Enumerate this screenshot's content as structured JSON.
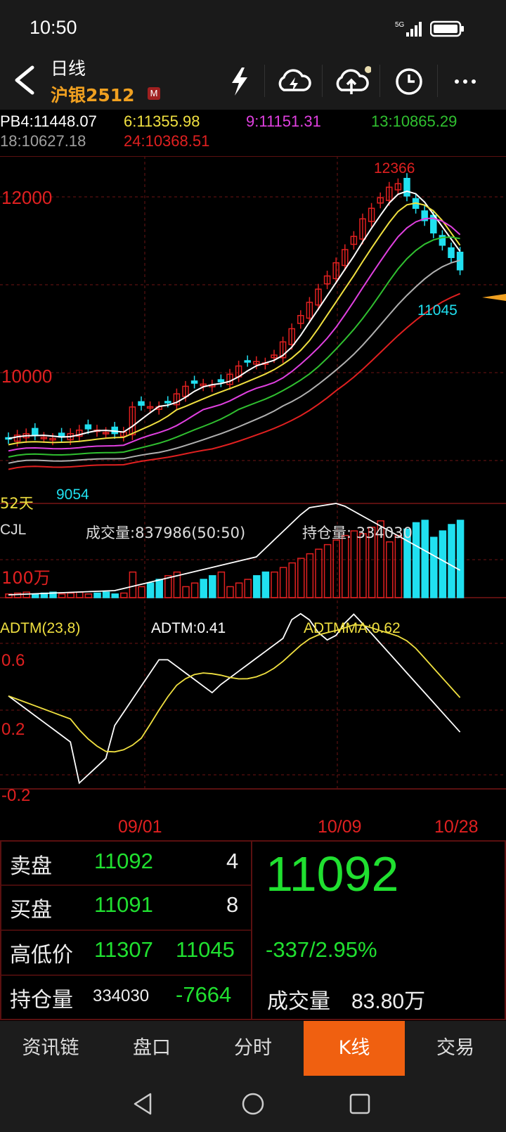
{
  "status": {
    "time": "10:50",
    "network": "5G"
  },
  "header": {
    "period": "日线",
    "contract": "沪银2512",
    "badge": "M",
    "icons": [
      "lightning-icon",
      "cloud-sync-icon",
      "cloud-upload-icon",
      "clock-icon",
      "more-icon"
    ]
  },
  "ma_row1": [
    {
      "label": "PB4:11448.07",
      "color": "#ffffff"
    },
    {
      "label": "6:11355.98",
      "color": "#f0e040"
    },
    {
      "label": "9:11151.31",
      "color": "#e040e0"
    },
    {
      "label": "13:10865.29",
      "color": "#30c030"
    }
  ],
  "ma_row2": [
    {
      "label": "18:10627.18",
      "color": "#b0b0b0"
    },
    {
      "label": "24:10368.51",
      "color": "#e02020"
    }
  ],
  "main_chart": {
    "y_labels": [
      "12000",
      "10000"
    ],
    "high_label": "12366",
    "low_label": "9054",
    "last_low_label": "11045",
    "period_label": "52天"
  },
  "volume": {
    "title": "CJL",
    "volume_text": "成交量:837986(50:50)",
    "oi_text": "持仓量: 334030",
    "y_label": "100万"
  },
  "adtm": {
    "title": "ADTM(23,8)",
    "value_text": "ADTM:0.41",
    "ma_text": "ADTMMA:0.62",
    "y_labels": [
      "0.6",
      "0.2",
      "-0.2"
    ]
  },
  "dates": [
    "09/01",
    "10/09",
    "10/28"
  ],
  "quote": {
    "sell_label": "卖盘",
    "sell_price": "11092",
    "sell_qty": "4",
    "buy_label": "买盘",
    "buy_price": "11091",
    "buy_qty": "8",
    "hl_label": "高低价",
    "high": "11307",
    "low": "11045",
    "oi_label": "持仓量",
    "oi_value": "334030",
    "oi_change": "-7664",
    "last_price": "11092",
    "change": "-337/2.95%",
    "volume_label": "成交量",
    "volume_value": "83.80万"
  },
  "tabs": [
    "资讯链",
    "盘口",
    "分时",
    "K线",
    "交易"
  ],
  "active_tab": "K线",
  "colors": {
    "up": "#e02020",
    "down": "#20e0f0",
    "accent": "#f06010",
    "green": "#20e030"
  }
}
